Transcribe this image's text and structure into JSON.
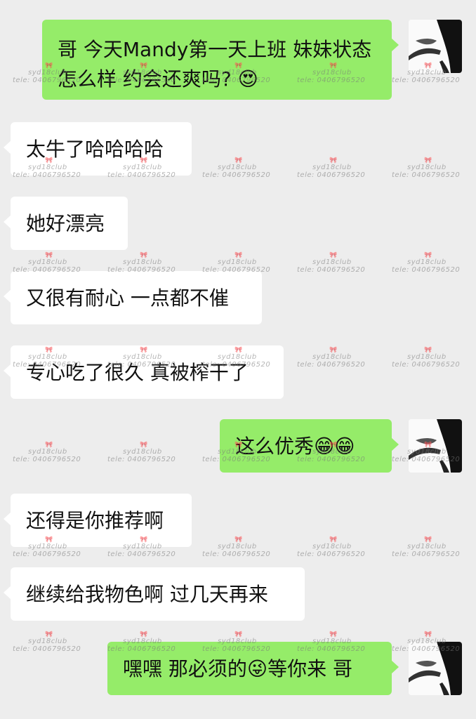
{
  "colors": {
    "background": "#ededed",
    "outgoing_bubble": "#95ec69",
    "incoming_bubble": "#ffffff"
  },
  "messages": [
    {
      "side": "out",
      "text": "哥 今天Mandy第一天上班 妹妹状态怎么样 约会还爽吗? 😍"
    },
    {
      "side": "in",
      "text": "太牛了哈哈哈哈"
    },
    {
      "side": "in",
      "text": "她好漂亮"
    },
    {
      "side": "in",
      "text": "又很有耐心 一点都不催"
    },
    {
      "side": "in",
      "text": "专心吃了很久 真被榨干了"
    },
    {
      "side": "out",
      "text": "这么优秀😁😁"
    },
    {
      "side": "in",
      "text": "还得是你推荐啊"
    },
    {
      "side": "in",
      "text": "继续给我物色啊 过几天再来"
    },
    {
      "side": "out",
      "text": "嘿嘿 那必须的😜等你来 哥"
    }
  ],
  "watermark": {
    "name": "syd18club",
    "phone": "tele: 0406796520",
    "mark": "🎀"
  }
}
